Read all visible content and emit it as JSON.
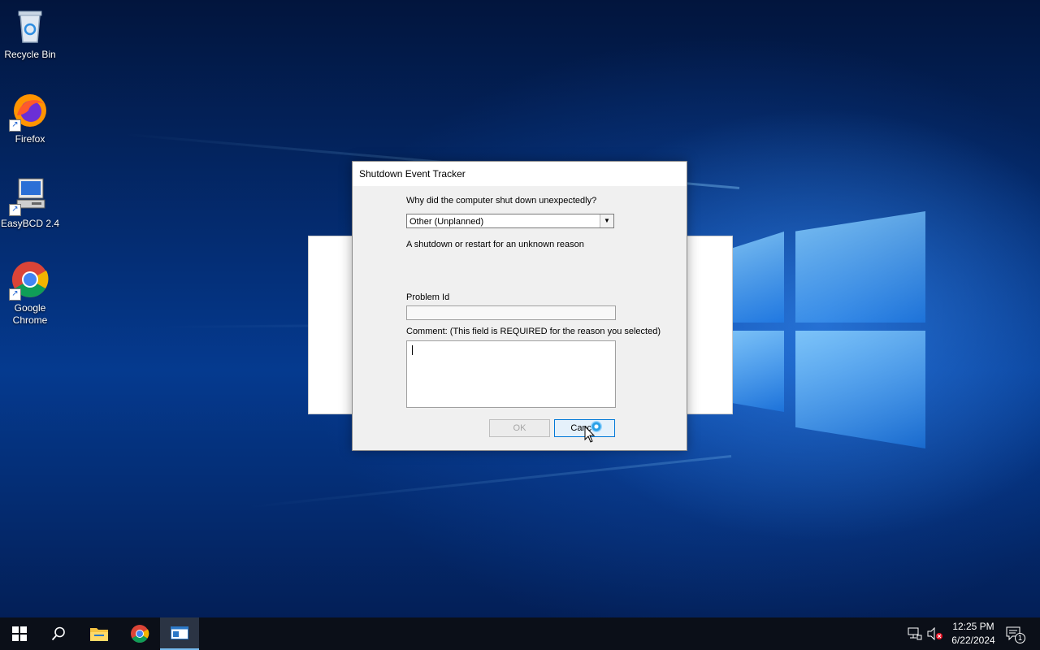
{
  "desktop": {
    "icons": [
      {
        "label": "Recycle Bin",
        "icon": "recycle-bin-icon"
      },
      {
        "label": "Firefox",
        "icon": "firefox-icon"
      },
      {
        "label": "EasyBCD 2.4",
        "icon": "easybcd-icon"
      },
      {
        "label": "Google Chrome",
        "icon": "chrome-icon"
      }
    ]
  },
  "dialog": {
    "title": "Shutdown Event Tracker",
    "question": "Why did the computer shut down unexpectedly?",
    "reason_selected": "Other (Unplanned)",
    "reason_description": "A shutdown or restart for an unknown reason",
    "problem_id_label": "Problem Id",
    "problem_id_value": "",
    "comment_label": "Comment: (This field is REQUIRED for the reason you selected)",
    "comment_value": "",
    "ok_label": "OK",
    "cancel_label": "Cancel"
  },
  "taskbar": {
    "time": "12:25 PM",
    "date": "6/22/2024",
    "notification_count": "1",
    "items": [
      "start-icon",
      "search-icon",
      "file-explorer-icon",
      "chrome-icon",
      "shutdown-tracker-icon"
    ]
  }
}
